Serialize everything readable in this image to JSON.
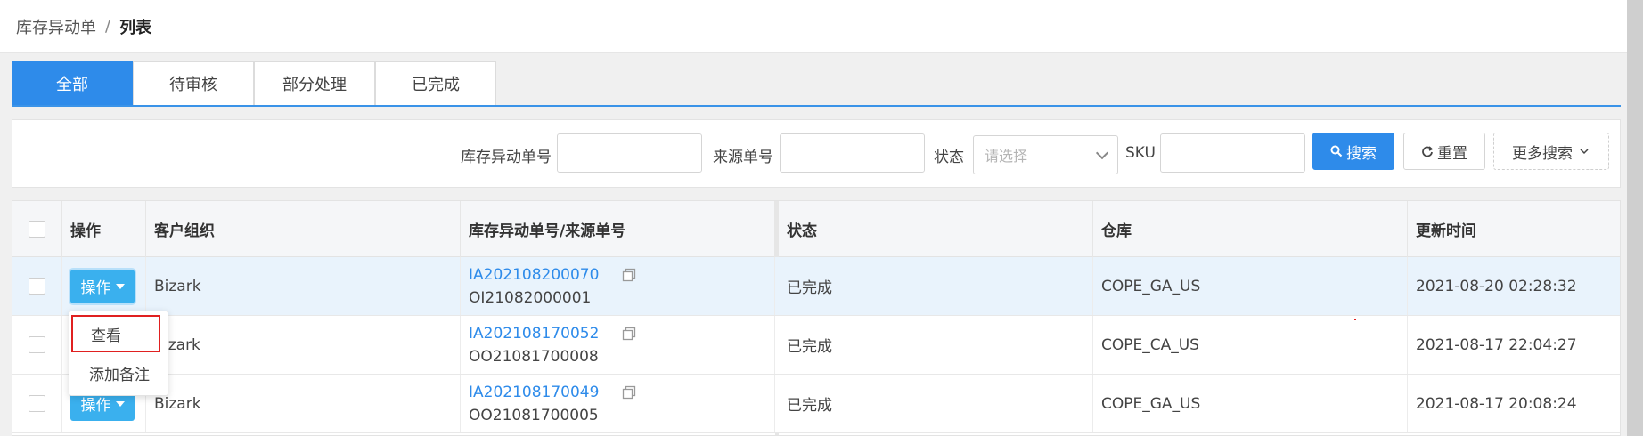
{
  "breadcrumb": {
    "parent": "库存异动单",
    "separator": "/",
    "current": "列表"
  },
  "tabs": [
    {
      "label": "全部",
      "active": true
    },
    {
      "label": "待审核",
      "active": false
    },
    {
      "label": "部分处理",
      "active": false
    },
    {
      "label": "已完成",
      "active": false
    }
  ],
  "search": {
    "adjust_no_label": "库存异动单号",
    "adjust_no_value": "",
    "source_no_label": "来源单号",
    "source_no_value": "",
    "status_label": "状态",
    "status_placeholder": "请选择",
    "sku_label": "SKU",
    "sku_value": "",
    "search_button": "搜索",
    "reset_button": "重置",
    "more_button": "更多搜索"
  },
  "table": {
    "headers": {
      "op": "操作",
      "org": "客户组织",
      "no": "库存异动单号/来源单号",
      "status": "状态",
      "warehouse": "仓库",
      "updated": "更新时间"
    },
    "op_button": "操作",
    "rows": [
      {
        "org": "Bizark",
        "adjust_no": "IA202108200070",
        "source_no": "OI21082000001",
        "status": "已完成",
        "warehouse": "COPE_GA_US",
        "updated": "2021-08-20 02:28:32"
      },
      {
        "org": "izark",
        "adjust_no": "IA202108170052",
        "source_no": "OO21081700008",
        "status": "已完成",
        "warehouse": "COPE_CA_US",
        "updated": "2021-08-17 22:04:27"
      },
      {
        "org": "Bizark",
        "adjust_no": "IA202108170049",
        "source_no": "OO21081700005",
        "status": "已完成",
        "warehouse": "COPE_GA_US",
        "updated": "2021-08-17 20:08:24"
      }
    ]
  },
  "dropdown": {
    "view": "查看",
    "add_note": "添加备注"
  },
  "colors": {
    "primary": "#2e8bea",
    "op_button": "#3ab0ee",
    "highlight_border": "#e02020",
    "link": "#2e8bea"
  }
}
